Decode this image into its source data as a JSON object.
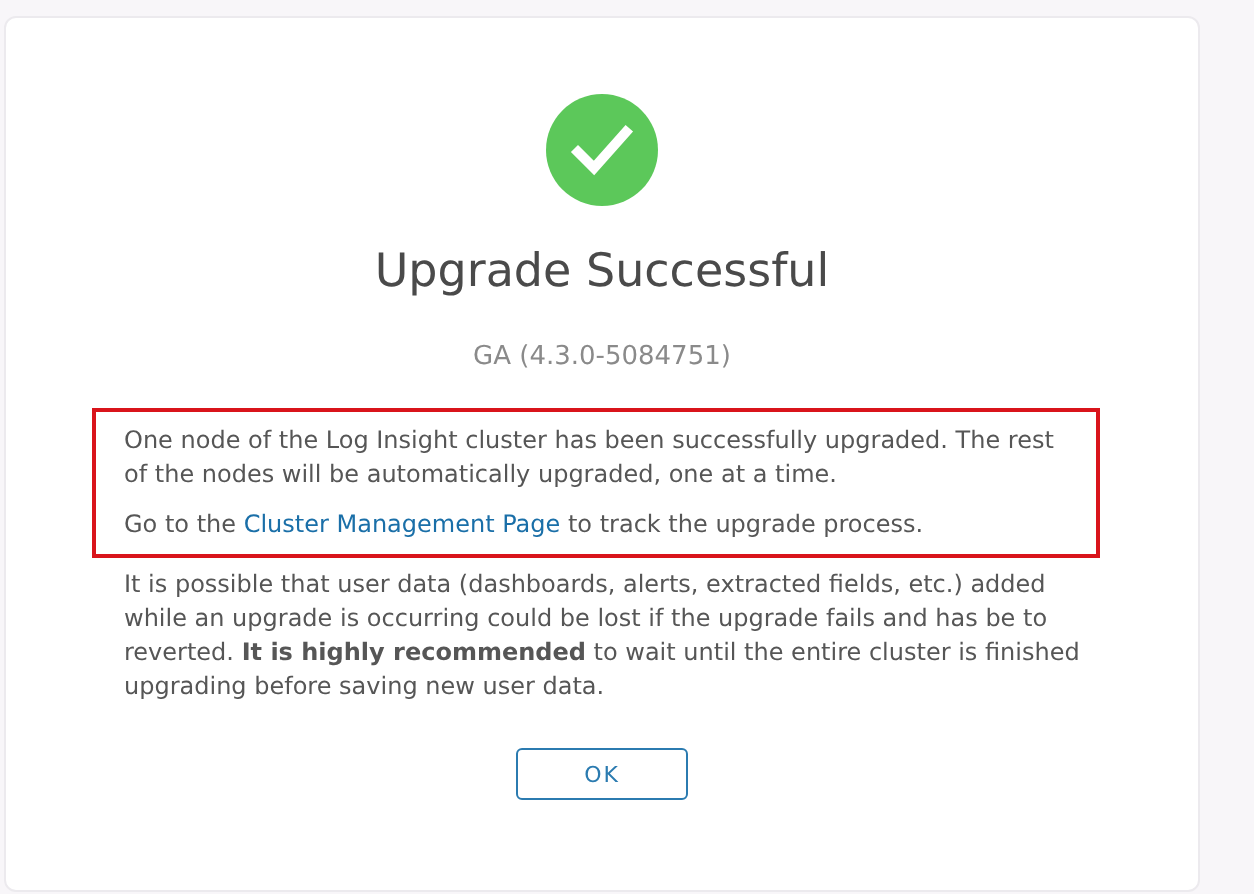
{
  "dialog": {
    "title": "Upgrade Successful",
    "version": "GA (4.3.0-5084751)",
    "highlight": {
      "message": "One node of the Log Insight cluster has been successfully upgraded. The rest of the nodes will be automatically upgraded, one at a time.",
      "link_sentence": {
        "before": "Go to the ",
        "link": "Cluster Management Page",
        "after": " to track the upgrade process."
      }
    },
    "warning": "It is possible that user data (dashboards, alerts, extracted fields, etc.) added while an upgrade is occurring could be lost if the upgrade fails and has be to reverted. **It is highly recommended** to wait until the entire cluster is finished upgrading before saving new user data.",
    "buttons": [
      "OK"
    ]
  }
}
